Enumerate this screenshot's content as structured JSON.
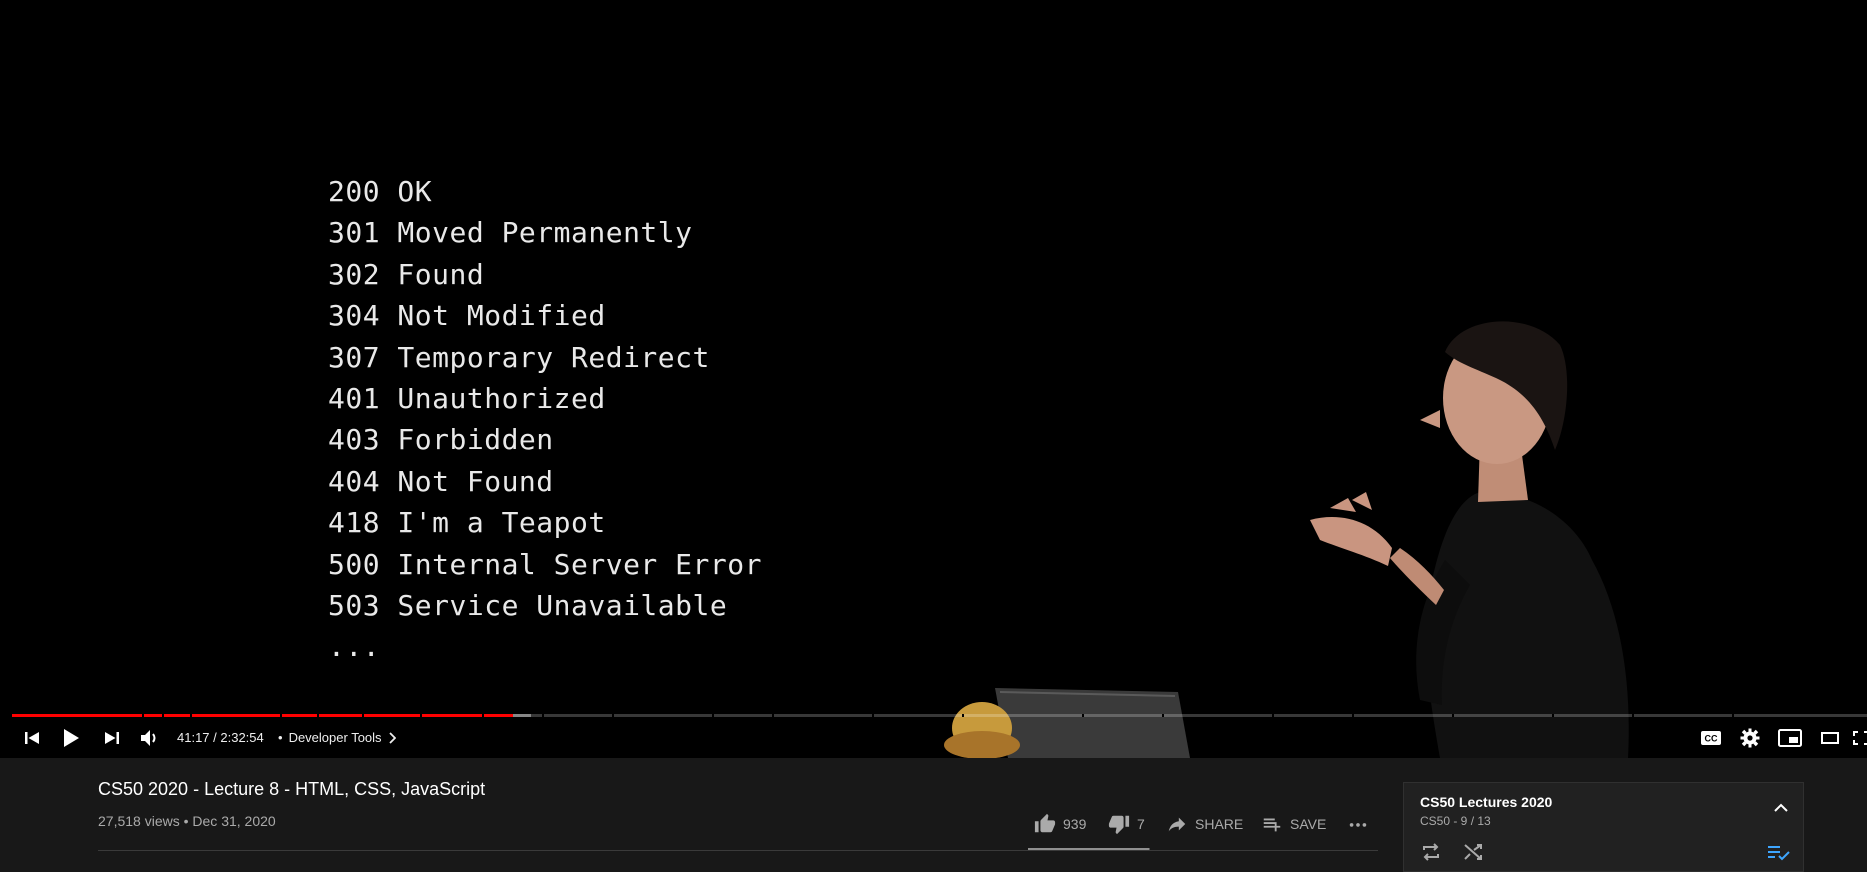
{
  "slide": {
    "lines": [
      "200 OK",
      "301 Moved Permanently",
      "302 Found",
      "304 Not Modified",
      "307 Temporary Redirect",
      "401 Unauthorized",
      "403 Forbidden",
      "404 Not Found",
      "418 I'm a Teapot",
      "500 Internal Server Error",
      "503 Service Unavailable",
      "..."
    ]
  },
  "player": {
    "time": "41:17 / 2:32:54",
    "separator": "•",
    "chapter": "Developer Tools",
    "played_fraction": 0.27,
    "buffered_fraction": 0.28,
    "accent_color": "#ff0000",
    "icons": {
      "prev": "skip-previous-icon",
      "play": "play-icon",
      "next": "skip-next-icon",
      "volume": "volume-icon",
      "cc": "cc-icon",
      "settings": "gear-icon",
      "miniplayer": "miniplayer-icon",
      "theater": "theater-mode-icon",
      "fullscreen": "fullscreen-icon"
    }
  },
  "video": {
    "title": "CS50 2020 - Lecture 8 - HTML, CSS, JavaScript",
    "views": "27,518 views",
    "meta_sep": "•",
    "date": "Dec 31, 2020"
  },
  "actions": {
    "likes": "939",
    "dislikes": "7",
    "share": "SHARE",
    "save": "SAVE",
    "like_ratio": 0.99
  },
  "playlist": {
    "title": "CS50 Lectures 2020",
    "subtitle": "CS50 - 9 / 13"
  }
}
